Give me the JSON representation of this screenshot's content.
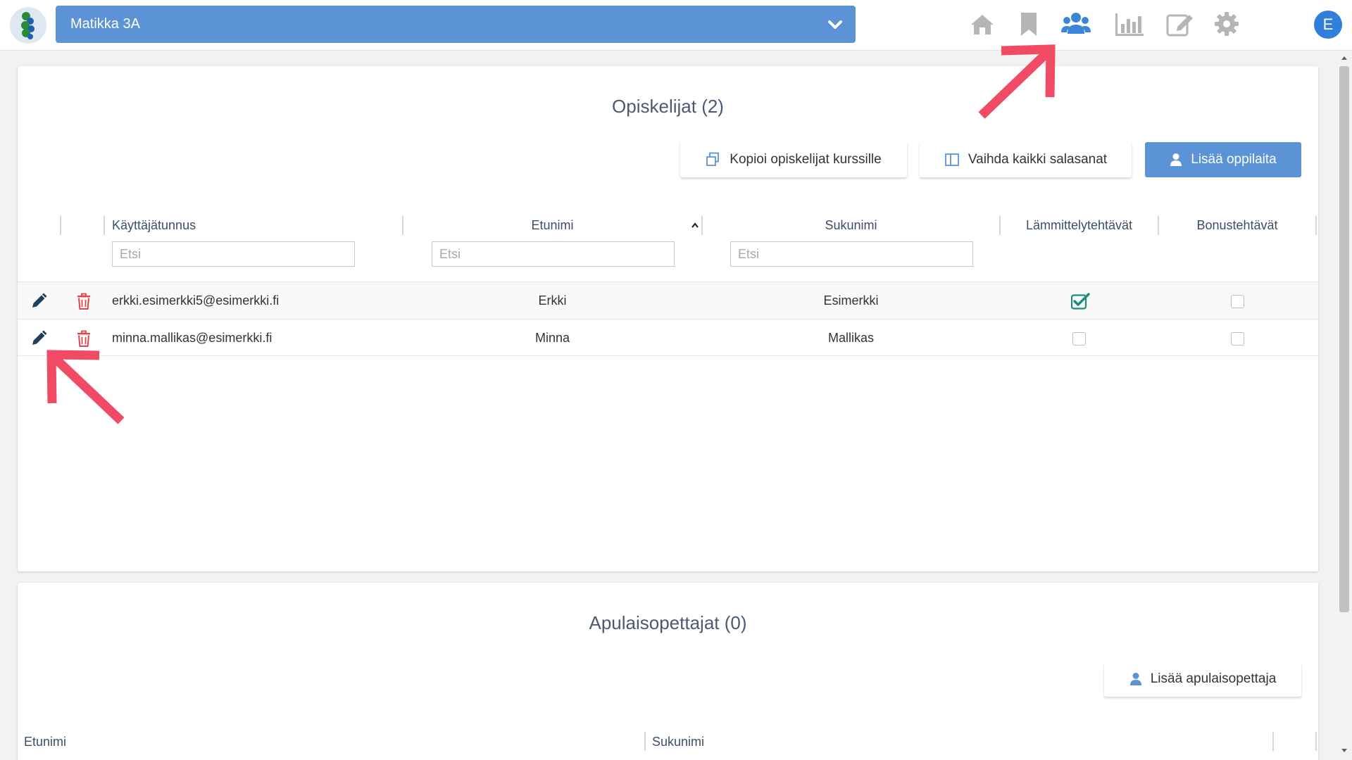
{
  "topbar": {
    "course_name": "Matikka 3A",
    "avatar_initial": "E",
    "nav_icons": [
      "home-icon",
      "bookmark-icon",
      "users-icon",
      "bar-chart-icon",
      "edit-icon",
      "gear-icon"
    ],
    "active_nav": "users-icon",
    "accent_color": "#5b93d6"
  },
  "students": {
    "title": "Opiskelijat (2)",
    "buttons": {
      "copy": "Kopioi opiskelijat kurssille",
      "change_passwords": "Vaihda kaikki salasanat",
      "add": "Lisää oppilaita"
    },
    "columns": {
      "username": "Käyttäjätunnus",
      "firstname": "Etunimi",
      "lastname": "Sukunimi",
      "warmup": "Lämmittelytehtävät",
      "bonus": "Bonustehtävät"
    },
    "search_placeholder": "Etsi",
    "rows": [
      {
        "username": "erkki.esimerkki5@esimerkki.fi",
        "firstname": "Erkki",
        "lastname": "Esimerkki",
        "warmup": true,
        "bonus": false
      },
      {
        "username": "minna.mallikas@esimerkki.fi",
        "firstname": "Minna",
        "lastname": "Mallikas",
        "warmup": false,
        "bonus": false
      }
    ]
  },
  "assistants": {
    "title": "Apulaisopettajat (0)",
    "add_button": "Lisää apulaisopettaja",
    "columns": {
      "firstname": "Etunimi",
      "lastname": "Sukunimi"
    }
  },
  "annotation_color": "#f04a65"
}
